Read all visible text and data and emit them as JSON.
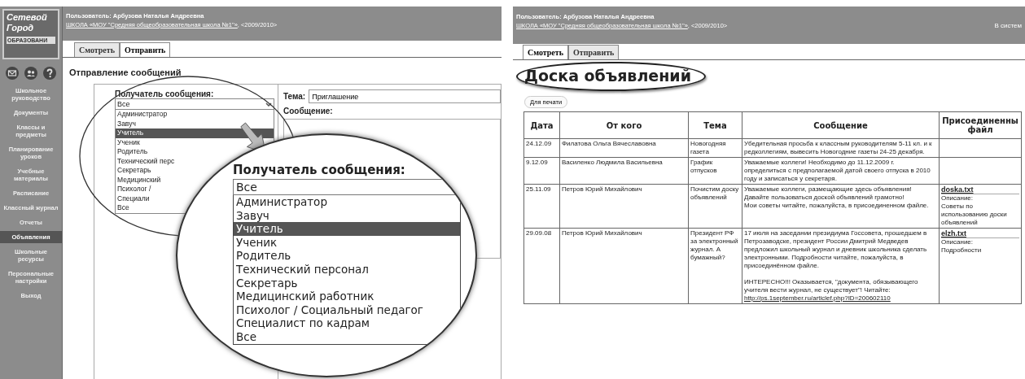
{
  "left_window": {
    "logo": {
      "line_1": "Сетевой",
      "line_2": "Город",
      "line_3": "ОБРАЗОВАНИ"
    },
    "sidebar": {
      "items": [
        {
          "label": "Школьное руководство",
          "selected": false
        },
        {
          "label": "Документы",
          "selected": false
        },
        {
          "label": "Классы и предметы",
          "selected": false
        },
        {
          "label": "Планирование уроков",
          "selected": false
        },
        {
          "label": "Учебные материалы",
          "selected": false
        },
        {
          "label": "Расписание",
          "selected": false
        },
        {
          "label": "Классный журнал",
          "selected": false
        },
        {
          "label": "Отчеты",
          "selected": false
        },
        {
          "label": "Объявления",
          "selected": true
        },
        {
          "label": "Школьные ресурсы",
          "selected": false
        },
        {
          "label": "Персональные настройки",
          "selected": false
        },
        {
          "label": "Выход",
          "selected": false
        }
      ]
    },
    "header": {
      "user": "Пользователь: Арбузова Наталья Андреевна",
      "school_link": "ШКОЛА «МОУ \"Средняя общеобразовательная школа №1\"»",
      "year": ", <2009/2010>"
    },
    "tabs": [
      {
        "label": "Смотреть",
        "selected": false
      },
      {
        "label": "Отправить",
        "selected": true
      }
    ],
    "heading": "Отправление сообщений",
    "form": {
      "recipient_label": "Получатель сообщения:",
      "recipient_value": "Все",
      "recipient_options": [
        {
          "label": "Администратор",
          "selected": false
        },
        {
          "label": "Завуч",
          "selected": false
        },
        {
          "label": "Учитель",
          "selected": true
        },
        {
          "label": "Ученик",
          "selected": false
        },
        {
          "label": "Родитель",
          "selected": false
        },
        {
          "label": "Технический перс",
          "selected": false
        },
        {
          "label": "Секретарь",
          "selected": false
        },
        {
          "label": "Медицинский",
          "selected": false
        },
        {
          "label": "Психолог /",
          "selected": false
        },
        {
          "label": "Специали",
          "selected": false
        },
        {
          "label": "Все",
          "selected": false
        }
      ],
      "subject_label": "Тема:",
      "subject_value": "Приглашение",
      "message_label": "Сообщение:"
    },
    "magnifier": {
      "recipient_label": "Получатель сообщения:",
      "recipient_value": "Все",
      "recipient_options": [
        {
          "label": "Администратор",
          "selected": false
        },
        {
          "label": "Завуч",
          "selected": false
        },
        {
          "label": "Учитель",
          "selected": true
        },
        {
          "label": "Ученик",
          "selected": false
        },
        {
          "label": "Родитель",
          "selected": false
        },
        {
          "label": "Технический персонал",
          "selected": false
        },
        {
          "label": "Секретарь",
          "selected": false
        },
        {
          "label": "Медицинский работник",
          "selected": false
        },
        {
          "label": "Психолог / Социальный педагог",
          "selected": false
        },
        {
          "label": "Специалист по кадрам",
          "selected": false
        },
        {
          "label": "Все",
          "selected": false
        }
      ]
    }
  },
  "right_window": {
    "header": {
      "user": "Пользователь: Арбузова Наталья Андреевна",
      "school_link": "ШКОЛА «МОУ \"Средняя общеобразовательная школа №1\"»",
      "year": ", <2009/2010>",
      "status": "В систем"
    },
    "tabs": [
      {
        "label": "Смотреть",
        "selected": true
      },
      {
        "label": "Отправить",
        "selected": false
      }
    ],
    "heading": "Доска объявлений",
    "print_button": "Для печати",
    "table": {
      "columns": [
        "Дата",
        "От кого",
        "Тема",
        "Сообщение",
        "Присоединенны файл"
      ],
      "rows": [
        {
          "date": "24.12.09",
          "from": "Филатова Ольга Вячеславовна",
          "subject": "Новогодняя газета",
          "message": [
            {
              "text": "Убедительная просьба к классным руководителям 5-11 кл. и к редколлегиям, вывесить Новогодние газеты 24-25 декабря.",
              "gap_before": false
            }
          ]
        },
        {
          "date": "9.12.09",
          "from": "Василенко Людмила Васильевна",
          "subject": "График отпусков",
          "message": [
            {
              "text": "Уважаемые коллеги! Необходимо до 11.12.2009 г. определиться с предполагаемой датой своего отпуска в 2010 году и записаться у секретаря.",
              "gap_before": false
            }
          ]
        },
        {
          "date": "25.11.09",
          "from": "Петров Юрий Михайлович",
          "subject": "Почистим доску объявлений",
          "message": [
            {
              "text": "Уважаемые коллеги, размещающие здесь объявления!",
              "gap_before": false
            },
            {
              "text": "Давайте пользоваться доской объявлений грамотно!",
              "gap_before": false
            },
            {
              "text": "Мои советы читайте, пожалуйста, в присоединенном файле.",
              "gap_before": false
            }
          ],
          "file": {
            "name": "doska.txt",
            "description_label": "Описание:",
            "description": "Советы по использованию доски объявлений"
          }
        },
        {
          "date": "29.09.08",
          "from": "Петров Юрий Михайлович",
          "subject": "Президент РФ за электронный журнал. А бумажный?",
          "message": [
            {
              "text": "17 июля на заседании президиума Госсовета, прошедшем в Петрозаводске, президент России Дмитрий Медведев предложил школьный журнал и дневник школьника сделать электронными. Подробности читайте, пожалуйста, в присоединённом файле.",
              "gap_before": false
            },
            {
              "text": "ИНТЕРЕСНО!!! Оказывается, \"документа, обязывающего учителя вести журнал, не существует\"! Читайте:",
              "gap_before": true
            }
          ],
          "link": "http://ps.1september.ru/articlef.php?ID=200602110",
          "file": {
            "name": "elzh.txt",
            "description_label": "Описание:",
            "description": "Подробности"
          }
        }
      ]
    }
  }
}
